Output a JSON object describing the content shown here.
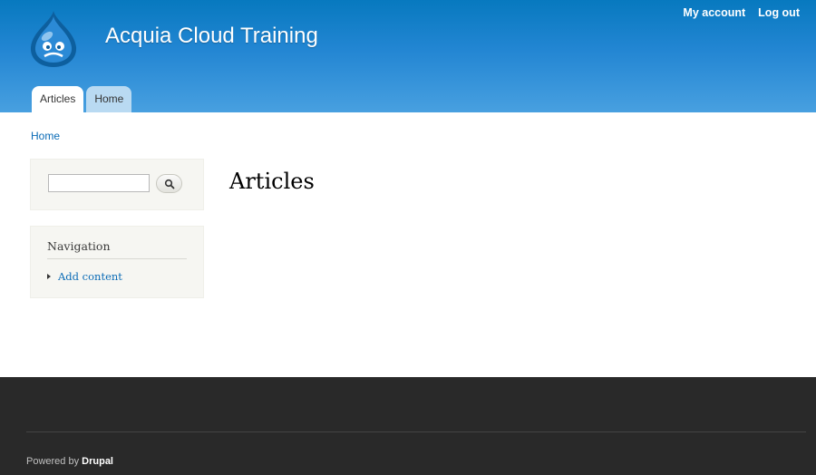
{
  "header": {
    "site_name": "Acquia Cloud Training",
    "logo_icon": "drupal-drop-icon",
    "background_color": "#2386d3",
    "secondary_menu": [
      "My account",
      "Log out"
    ],
    "tabs": [
      {
        "label": "Articles",
        "active": true
      },
      {
        "label": "Home",
        "active": false
      }
    ]
  },
  "breadcrumb": {
    "items": [
      "Home"
    ]
  },
  "sidebar": {
    "search": {
      "value": "",
      "placeholder": "",
      "button_icon": "search-icon"
    },
    "navigation": {
      "title": "Navigation",
      "items": [
        {
          "label": "Add content"
        }
      ]
    }
  },
  "main": {
    "title": "Articles"
  },
  "footer": {
    "background_color": "#292929",
    "powered_by": "Powered by",
    "drupal_link": "Drupal"
  },
  "colors": {
    "link": "#0a6bb6",
    "block_background": "#f6f6f2"
  }
}
